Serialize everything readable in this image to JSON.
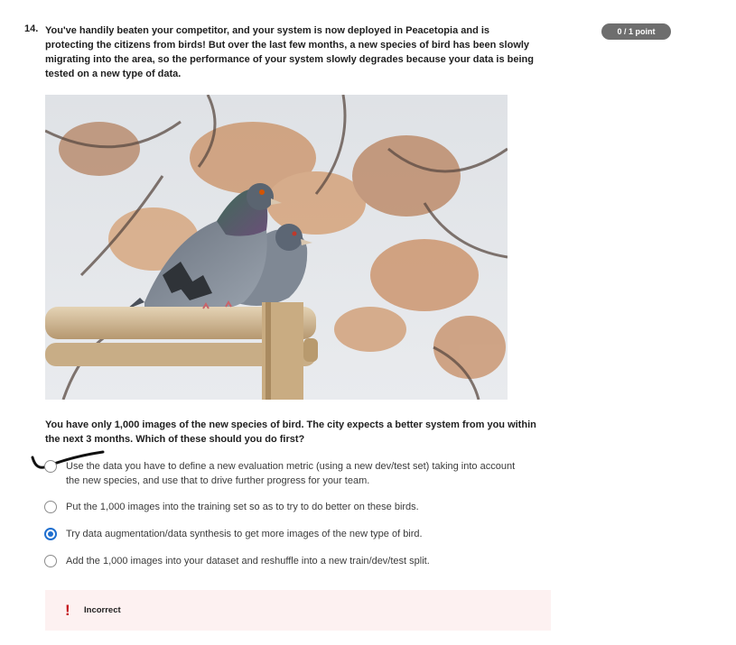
{
  "question": {
    "number": "14.",
    "text": "You've handily beaten your competitor, and your system is now deployed in Peacetopia and is protecting the citizens from birds! But over the last few months, a new species of bird has been slowly migrating into the area, so the performance of your system slowly degrades because your data is being tested on a new type of data.",
    "points_badge": "0 / 1 point",
    "image_subject": "pigeons-on-wooden-fence",
    "subquestion": "You have only 1,000 images of the new species of bird. The city expects a better system from you within the next 3 months. Which of these should you do first?"
  },
  "options": [
    {
      "label": "Use the data you have to define a new evaluation metric (using a new dev/test set) taking into account the new species, and use that to drive further progress for your team.",
      "selected": false
    },
    {
      "label": "Put the 1,000 images into the training set so as to try to do better on these birds.",
      "selected": false
    },
    {
      "label": "Try data augmentation/data synthesis to get more images of the new type of bird.",
      "selected": true
    },
    {
      "label": "Add the 1,000 images into your dataset and reshuffle into a new train/dev/test split.",
      "selected": false
    }
  ],
  "feedback": {
    "icon": "exclamation-icon",
    "text": "Incorrect"
  },
  "colors": {
    "badge_bg": "#6e6e6e",
    "selected_radio": "#1f6fcf",
    "feedback_bg": "#fdf1f1",
    "feedback_icon": "#c4161c"
  }
}
